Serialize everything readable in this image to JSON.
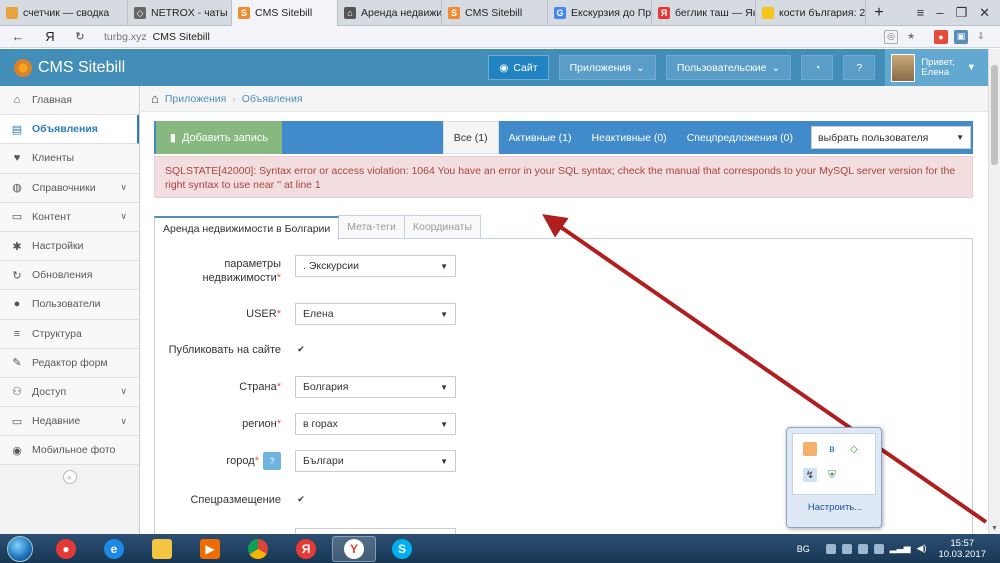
{
  "browser": {
    "tabs": [
      {
        "label": "счетчик — сводка",
        "icon_color": "#e8a33d"
      },
      {
        "label": "NETROX - чаты",
        "icon_color": "#666666"
      },
      {
        "label": "CMS Sitebill",
        "icon_color": "#f28a2e",
        "icon_letter": "S",
        "active": true
      },
      {
        "label": "Аренда недвижим",
        "icon_color": "#555555"
      },
      {
        "label": "CMS Sitebill",
        "icon_color": "#f28a2e",
        "icon_letter": "S"
      },
      {
        "label": "Екскурзия до Пра",
        "icon_color": "#4285f4",
        "icon_letter": "G"
      },
      {
        "label": "беглик таш — Янд",
        "icon_color": "#e53935",
        "icon_letter": "Я"
      },
      {
        "label": "кости българия: 2",
        "icon_color": "#f5c518"
      }
    ],
    "new_tab": "+",
    "url_host": "turbg.xyz",
    "page_title": "CMS Sitebill"
  },
  "app": {
    "logo_text": "CMS Sitebill",
    "header_buttons": {
      "site": "Сайт",
      "apps": "Приложения",
      "custom": "Пользовательские"
    },
    "user_greeting": "Привет,",
    "user_name": "Елена"
  },
  "sidebar": {
    "items": [
      {
        "label": "Главная",
        "icon": "home-icon",
        "glyph": "⌂"
      },
      {
        "label": "Объявления",
        "icon": "list-icon",
        "glyph": "▤",
        "active": true
      },
      {
        "label": "Клиенты",
        "icon": "heart-icon",
        "glyph": "♥"
      },
      {
        "label": "Справочники",
        "icon": "globe-icon",
        "glyph": "◍",
        "chevron": true
      },
      {
        "label": "Контент",
        "icon": "desktop-icon",
        "glyph": "▭",
        "chevron": true
      },
      {
        "label": "Настройки",
        "icon": "gear-icon",
        "glyph": "✱"
      },
      {
        "label": "Обновления",
        "icon": "refresh-icon",
        "glyph": "↻"
      },
      {
        "label": "Пользователи",
        "icon": "user-icon",
        "glyph": "●"
      },
      {
        "label": "Структура",
        "icon": "structure-icon",
        "glyph": "≡"
      },
      {
        "label": "Редактор форм",
        "icon": "edit-icon",
        "glyph": "✎"
      },
      {
        "label": "Доступ",
        "icon": "users-icon",
        "glyph": "⚇",
        "chevron": true
      },
      {
        "label": "Недавние",
        "icon": "monitor-icon",
        "glyph": "▭",
        "chevron": true
      },
      {
        "label": "Мобильное фото",
        "icon": "camera-icon",
        "glyph": "◉"
      }
    ],
    "collapse_glyph": "«"
  },
  "breadcrumb": {
    "home_icon": "home-icon",
    "items": [
      "Приложения",
      "Объявления"
    ]
  },
  "toolbar": {
    "add_label": "Добавить запись",
    "filters": [
      {
        "label": "Все (1)",
        "active": true
      },
      {
        "label": "Активные (1)"
      },
      {
        "label": "Неактивные (0)"
      },
      {
        "label": "Спецпредложения (0)"
      }
    ],
    "user_select": "выбрать пользователя"
  },
  "alert": {
    "text": "SQLSTATE[42000]: Syntax error or access violation: 1064 You have an error in your SQL syntax; check the manual that corresponds to your MySQL server version for the right syntax to use near '' at line 1"
  },
  "form": {
    "tabs": [
      "Аренда недвижимости в Болгарии",
      "Мета-теги",
      "Координаты"
    ],
    "fields": [
      {
        "label": "параметры недвижимости",
        "required": true,
        "type": "select",
        "value": ". Экскурсии"
      },
      {
        "label": "USER",
        "required": true,
        "type": "select",
        "value": "Елена"
      },
      {
        "label": "Публиковать на сайте",
        "required": false,
        "type": "checkbox",
        "checked": true
      },
      {
        "label": "Страна",
        "required": true,
        "type": "select",
        "value": "Болгария"
      },
      {
        "label": "регион",
        "required": true,
        "type": "select",
        "value": "в горах"
      },
      {
        "label": "город",
        "required": true,
        "type": "select",
        "value": "Българи",
        "help": true
      },
      {
        "label": "Спецразмещение",
        "required": false,
        "type": "checkbox",
        "checked": true
      }
    ]
  },
  "tray_popup": {
    "customize_label": "Настроить..."
  },
  "taskbar": {
    "lang": "BG",
    "time": "15:57",
    "date": "10.03.2017"
  },
  "colors": {
    "header": "#438eb9",
    "toolbar": "#428bca",
    "add_button": "#87b87f",
    "alert_bg": "#f2dede",
    "alert_text": "#a94442",
    "annotation_arrow": "#b01e1e"
  }
}
